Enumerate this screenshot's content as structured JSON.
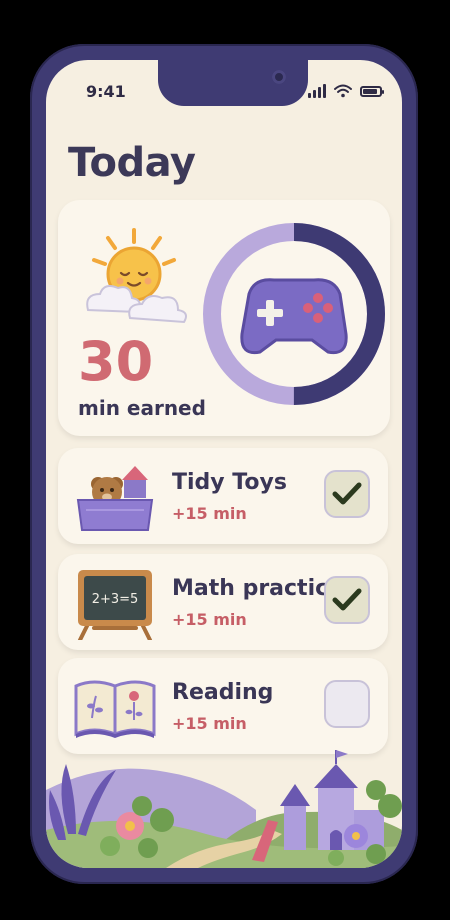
{
  "status_bar": {
    "time": "9:41"
  },
  "page": {
    "title": "Today"
  },
  "summary": {
    "earned_value": "30",
    "earned_label": "min earned",
    "progress_fraction": 0.5,
    "icons": {
      "weather": "sun-cloud-icon",
      "reward": "game-controller-icon"
    }
  },
  "tasks": [
    {
      "title": "Tidy Toys",
      "reward": "+15 min",
      "completed": true,
      "icon": "toy-box-icon"
    },
    {
      "title": "Math practice",
      "reward": "+15 min",
      "completed": true,
      "icon": "chalkboard-icon"
    },
    {
      "title": "Reading",
      "reward": "+15 min",
      "completed": false,
      "icon": "open-book-icon"
    }
  ],
  "colors": {
    "accent_purple": "#3f3b73",
    "reward_red": "#c65e66",
    "background": "#f6efe1",
    "ring_light": "#b9a9dc",
    "ring_dark": "#3e3a73"
  }
}
